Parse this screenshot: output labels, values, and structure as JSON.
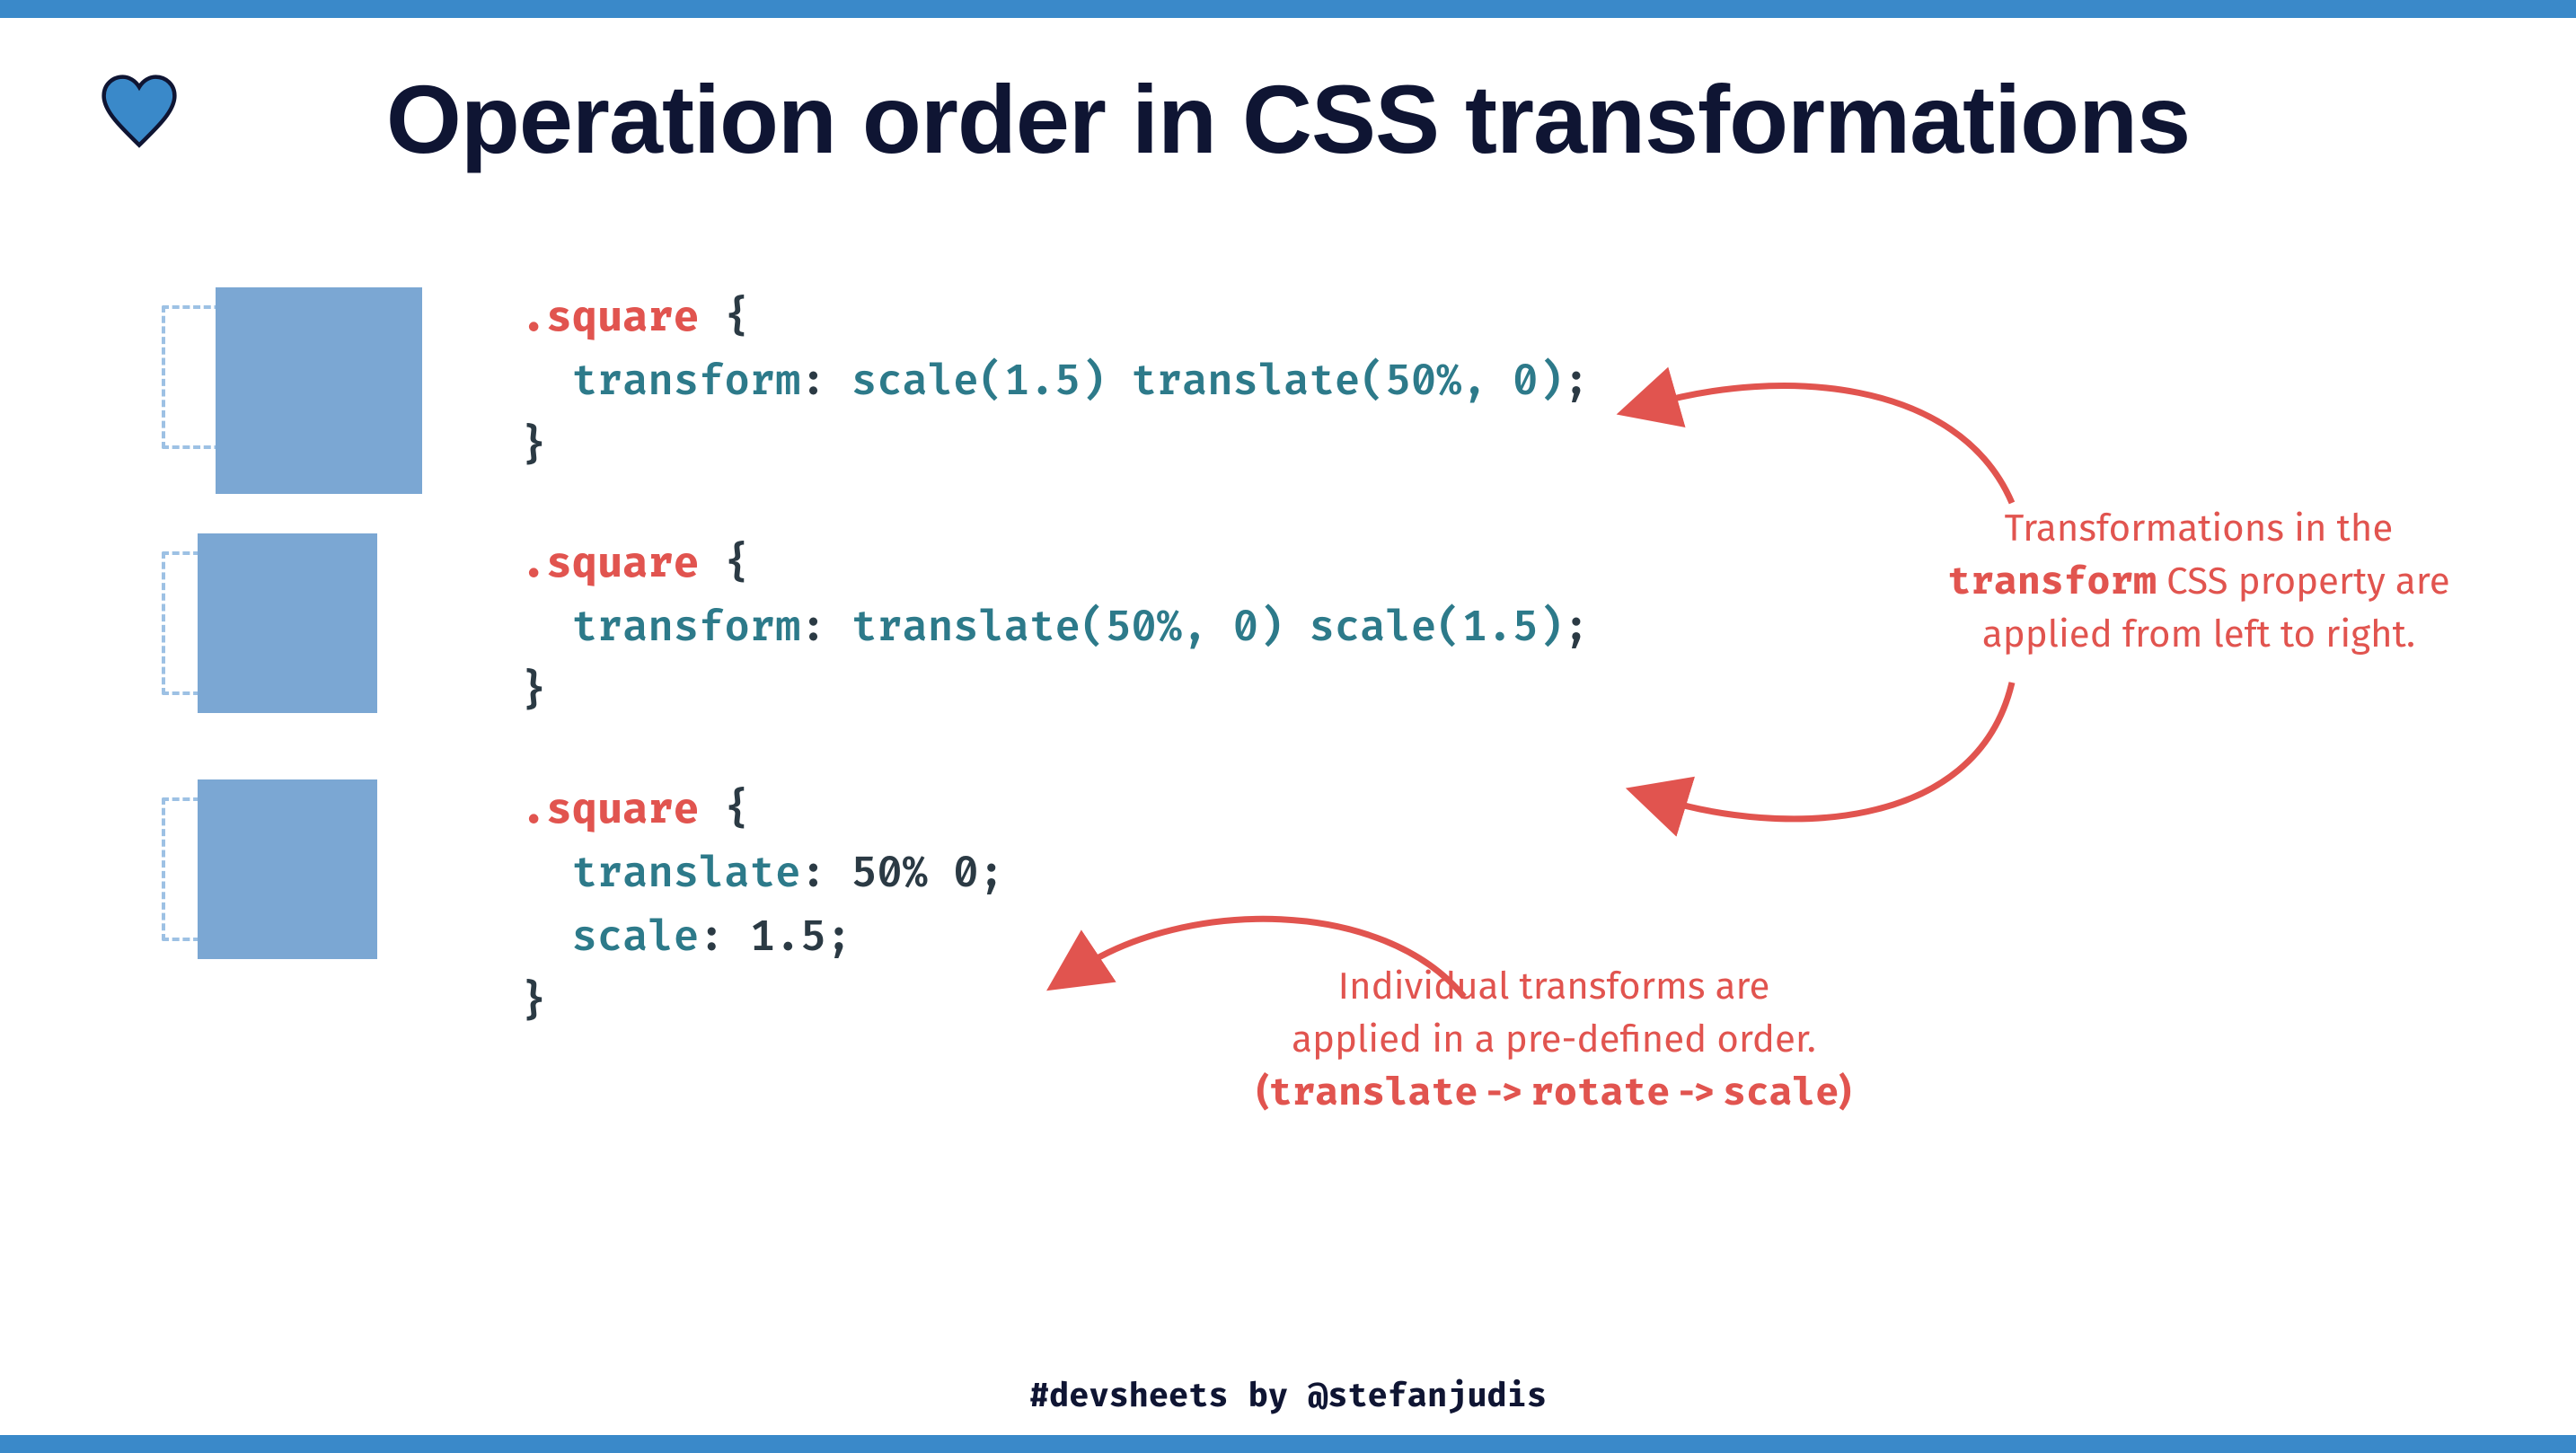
{
  "title": "Operation order in CSS transformations",
  "colors": {
    "accent_blue": "#3a89c9",
    "square_fill": "#7ba7d3",
    "square_ghost": "#9dc1e4",
    "annotation_red": "#e1544f",
    "heading_navy": "#0f1533",
    "code_teal": "#2d7a8a"
  },
  "examples": [
    {
      "selector": ".square",
      "lines": [
        {
          "prop": "transform",
          "value_parts": [
            "scale(",
            "1.5",
            ") ",
            "translate(",
            "50%",
            ", ",
            "0",
            ")"
          ]
        }
      ]
    },
    {
      "selector": ".square",
      "lines": [
        {
          "prop": "transform",
          "value_parts": [
            "translate(",
            "50%",
            ", ",
            "0",
            ") ",
            "scale(",
            "1.5",
            ")"
          ]
        }
      ]
    },
    {
      "selector": ".square",
      "lines": [
        {
          "prop": "translate",
          "value_plain": "50% 0"
        },
        {
          "prop": "scale",
          "value_plain": "1.5"
        }
      ]
    }
  ],
  "annotations": {
    "a1_line1": "Transformations in the",
    "a1_code": "transform",
    "a1_line2_rest": " CSS property are",
    "a1_line3": "applied from left to right.",
    "a2_line1": "Individual transforms are",
    "a2_line2": "applied in a pre-defined order.",
    "a2_order_open": "(",
    "a2_translate": "translate",
    "a2_sep1": " -> ",
    "a2_rotate": "rotate",
    "a2_sep2": " -> ",
    "a2_scale": "scale",
    "a2_order_close": ")"
  },
  "footer": {
    "hashtag": "#devsheets",
    "by": " by ",
    "handle": "@stefanjudis"
  }
}
